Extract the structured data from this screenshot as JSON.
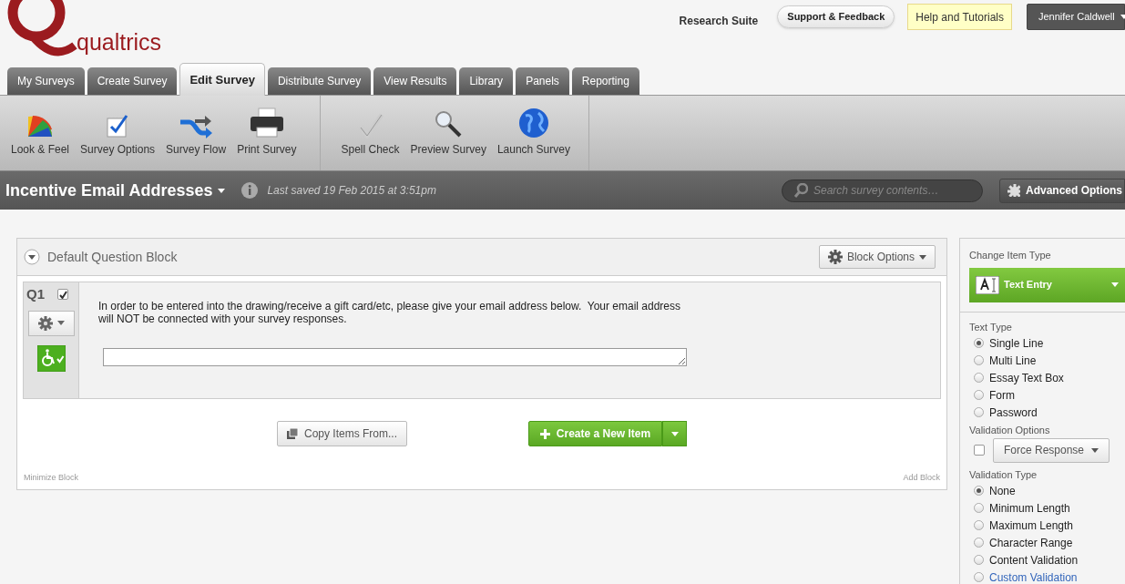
{
  "header": {
    "brand": "qualtrics",
    "suite": "Research Suite",
    "support": "Support & Feedback",
    "help": "Help and Tutorials",
    "user": "Jennifer Caldwell"
  },
  "tabs": [
    {
      "label": "My Surveys",
      "selected": false
    },
    {
      "label": "Create Survey",
      "selected": false
    },
    {
      "label": "Edit Survey",
      "selected": true
    },
    {
      "label": "Distribute Survey",
      "selected": false
    },
    {
      "label": "View Results",
      "selected": false
    },
    {
      "label": "Library",
      "selected": false
    },
    {
      "label": "Panels",
      "selected": false
    },
    {
      "label": "Reporting",
      "selected": false
    }
  ],
  "toolbar": [
    [
      {
        "label": "Look & Feel",
        "kind": "palette"
      },
      {
        "label": "Survey Options",
        "kind": "checkbox"
      },
      {
        "label": "Survey Flow",
        "kind": "flow"
      },
      {
        "label": "Print Survey",
        "kind": "printer"
      }
    ],
    [
      {
        "label": "Spell Check",
        "kind": "check"
      },
      {
        "label": "Preview Survey",
        "kind": "magnifier"
      },
      {
        "label": "Launch Survey",
        "kind": "globe"
      }
    ]
  ],
  "survey_bar": {
    "title": "Incentive Email Addresses",
    "last_saved": "Last saved 19 Feb 2015 at 3:51pm",
    "search_placeholder": "Search survey contents…",
    "advanced": "Advanced Options"
  },
  "block": {
    "title": "Default Question Block",
    "options": "Block Options",
    "question": {
      "number": "Q1",
      "checked": true,
      "text": "In order to be entered into the drawing/receive a gift card/etc, please give your email address below.  Your email address will NOT be connected with your survey responses."
    },
    "copy": "Copy Items From...",
    "create": "Create a New Item",
    "minimize": "Minimize Block",
    "add": "Add Block"
  },
  "side_panel": {
    "change_label": "Change Item Type",
    "item_type": "Text Entry",
    "text_type_label": "Text Type",
    "text_types": [
      {
        "label": "Single Line",
        "selected": true
      },
      {
        "label": "Multi Line",
        "selected": false
      },
      {
        "label": "Essay Text Box",
        "selected": false
      },
      {
        "label": "Form",
        "selected": false
      },
      {
        "label": "Password",
        "selected": false
      }
    ],
    "validation_options_label": "Validation Options",
    "force_response": {
      "label": "Force Response",
      "checked": false
    },
    "validation_type_label": "Validation Type",
    "validation_types": [
      {
        "label": "None",
        "selected": true,
        "link": false
      },
      {
        "label": "Minimum Length",
        "selected": false,
        "link": false
      },
      {
        "label": "Maximum Length",
        "selected": false,
        "link": false
      },
      {
        "label": "Character Range",
        "selected": false,
        "link": false
      },
      {
        "label": "Content Validation",
        "selected": false,
        "link": false
      },
      {
        "label": "Custom Validation",
        "selected": false,
        "link": true
      }
    ]
  }
}
